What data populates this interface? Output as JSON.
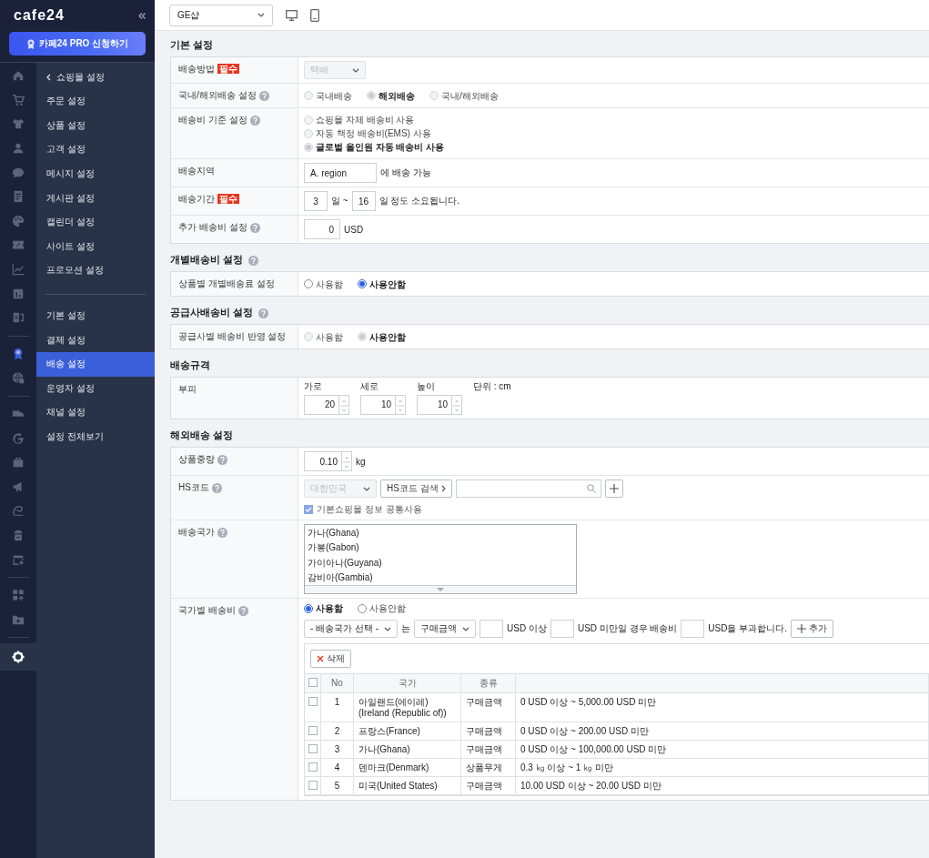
{
  "brand": {
    "logo": "cafe24",
    "pro_button": "카페24 PRO 신청하기"
  },
  "rail_groups": [
    [
      {
        "kind": "home",
        "selected": false
      },
      {
        "kind": "cart",
        "selected": false
      },
      {
        "kind": "shirt",
        "selected": false
      },
      {
        "kind": "person",
        "selected": false
      },
      {
        "kind": "chat",
        "selected": false
      },
      {
        "kind": "document",
        "selected": false
      },
      {
        "kind": "palette",
        "selected": false
      },
      {
        "kind": "ticket",
        "selected": false
      },
      {
        "kind": "chart",
        "selected": false
      },
      {
        "kind": "board",
        "selected": false
      },
      {
        "kind": "exit",
        "selected": false
      }
    ],
    [
      {
        "kind": "ribbon",
        "selected": false
      },
      {
        "kind": "globe",
        "selected": false
      }
    ],
    [
      {
        "kind": "truck",
        "selected": false
      },
      {
        "kind": "google",
        "selected": false
      },
      {
        "kind": "bag",
        "selected": false
      },
      {
        "kind": "megaphone",
        "selected": false
      },
      {
        "kind": "swirl",
        "selected": false
      },
      {
        "kind": "robot",
        "selected": false
      },
      {
        "kind": "calendar",
        "selected": false
      }
    ],
    [
      {
        "kind": "apps",
        "selected": false
      },
      {
        "kind": "folder",
        "selected": false
      }
    ],
    [
      {
        "kind": "gear",
        "selected": true
      }
    ]
  ],
  "submenu": {
    "back": "쇼핑몰 설정",
    "groups": [
      [
        {
          "label": "주문 설정",
          "selected": false
        },
        {
          "label": "상품 설정",
          "selected": false
        },
        {
          "label": "고객 설정",
          "selected": false
        },
        {
          "label": "메시지 설정",
          "selected": false
        },
        {
          "label": "게시판 설정",
          "selected": false
        },
        {
          "label": "캘린더 설정",
          "selected": false
        },
        {
          "label": "사이트 설정",
          "selected": false
        },
        {
          "label": "프로모션 설정",
          "selected": false
        }
      ],
      [
        {
          "label": "기본 설정",
          "selected": false
        },
        {
          "label": "결제 설정",
          "selected": false
        },
        {
          "label": "배송 설정",
          "selected": true
        },
        {
          "label": "운영자 설정",
          "selected": false
        },
        {
          "label": "채널 설정",
          "selected": false
        },
        {
          "label": "설정 전체보기",
          "selected": false
        }
      ]
    ]
  },
  "toolbar": {
    "shop_select": "GE샵"
  },
  "sections": [
    {
      "title": "기본 설정",
      "help": false,
      "rows": [
        {
          "label": "배송방법",
          "badge": "필수",
          "help": false,
          "kind": "select",
          "value": "택배",
          "disabled": true
        },
        {
          "label": "국내/해외배송 설정",
          "help": true,
          "kind": "radios",
          "disabled": true,
          "vertical": false,
          "options": [
            {
              "label": "국내배송",
              "selected": false
            },
            {
              "label": "해외배송",
              "selected": true
            },
            {
              "label": "국내/해외배송",
              "selected": false
            }
          ]
        },
        {
          "label": "배송비 기준 설정",
          "help": true,
          "kind": "radios",
          "disabled": true,
          "vertical": true,
          "options": [
            {
              "label": "쇼핑몰 자체 배송비 사용",
              "selected": false
            },
            {
              "label": "자동 책정 배송비(EMS) 사용",
              "selected": false
            },
            {
              "label": "글로벌 올인원 자동 배송비 사용",
              "selected": true
            }
          ]
        },
        {
          "label": "배송지역",
          "help": false,
          "kind": "text",
          "value": "A. region",
          "suffix": "에 배송 가능"
        },
        {
          "label": "배송기간",
          "badge": "필수",
          "help": false,
          "kind": "range",
          "from": "3",
          "separator": "일 ~",
          "to": "16",
          "suffix": "일 정도 소요됩니다."
        },
        {
          "label": "추가 배송비 설정",
          "help": true,
          "kind": "number",
          "value": "0",
          "unit": "USD"
        }
      ]
    },
    {
      "title": "개별배송비 설정",
      "help": true,
      "rows": [
        {
          "label": "상품별 개별배송료 설정",
          "help": false,
          "kind": "radios",
          "disabled": false,
          "vertical": false,
          "options": [
            {
              "label": "사용함",
              "selected": false
            },
            {
              "label": "사용안함",
              "selected": true
            }
          ]
        }
      ]
    },
    {
      "title": "공급사배송비 설정",
      "help": true,
      "rows": [
        {
          "label": "공급사별 배송비 반영 설정",
          "help": false,
          "kind": "radios",
          "disabled": true,
          "vertical": false,
          "options": [
            {
              "label": "사용함",
              "selected": false
            },
            {
              "label": "사용안함",
              "selected": true
            }
          ]
        }
      ]
    },
    {
      "title": "배송규격",
      "help": false,
      "rows": [
        {
          "label": "부피",
          "help": false,
          "kind": "dimensions",
          "unit": "단위 : cm",
          "fields": [
            {
              "label": "가로",
              "value": "20"
            },
            {
              "label": "세로",
              "value": "10"
            },
            {
              "label": "높이",
              "value": "10"
            }
          ]
        }
      ]
    },
    {
      "title": "해외배송 설정",
      "help": false,
      "rows": [
        {
          "label": "상품중량",
          "help": true,
          "kind": "spinner",
          "value": "0.10",
          "unit": "kg"
        },
        {
          "label": "HS코드",
          "help": true,
          "kind": "hs_code",
          "country": "대한민국",
          "search_button": "HS코드 검색",
          "checkbox": {
            "label": "기본쇼핑몰 정보 공통사용",
            "checked": true
          }
        },
        {
          "label": "배송국가",
          "help": true,
          "kind": "listbox",
          "items": [
            "가나(Ghana)",
            "가봉(Gabon)",
            "가이아나(Guyana)",
            "감비아(Gambia)"
          ]
        },
        {
          "label": "국가별 배송비",
          "help": true,
          "kind": "country_fees",
          "options": [
            {
              "label": "사용함",
              "selected": true
            },
            {
              "label": "사용안함",
              "selected": false
            }
          ],
          "country_select": "- 배송국가 선택 -",
          "joiner": "는",
          "basis_select": "구매금액",
          "text_min": "USD 이상",
          "text_max": "USD 미만일 경우 배송비",
          "text_fee": "USD을 부과합니다.",
          "add_button": "추가",
          "delete_button": "삭제",
          "table": {
            "header_checked": false,
            "columns": [
              "No",
              "국가",
              "종류"
            ],
            "rows": [
              {
                "checked": false,
                "no": "1",
                "country": "아일랜드(에이레)(Ireland (Republic of))",
                "type": "구매금액",
                "range": "0 USD 이상 ~ 5,000.00 USD 미만"
              },
              {
                "checked": false,
                "no": "2",
                "country": "프랑스(France)",
                "type": "구매금액",
                "range": "0 USD 이상 ~ 200.00 USD 미만"
              },
              {
                "checked": false,
                "no": "3",
                "country": "가나(Ghana)",
                "type": "구매금액",
                "range": "0 USD 이상 ~ 100,000.00 USD 미만"
              },
              {
                "checked": false,
                "no": "4",
                "country": "덴마크(Denmark)",
                "type": "상품무게",
                "range": "0.3 ㎏ 이상 ~ 1 ㎏ 미만"
              },
              {
                "checked": false,
                "no": "5",
                "country": "미국(United States)",
                "type": "구매금액",
                "range": "10.00 USD 이상 ~ 20.00 USD 미만"
              }
            ]
          }
        }
      ]
    }
  ]
}
